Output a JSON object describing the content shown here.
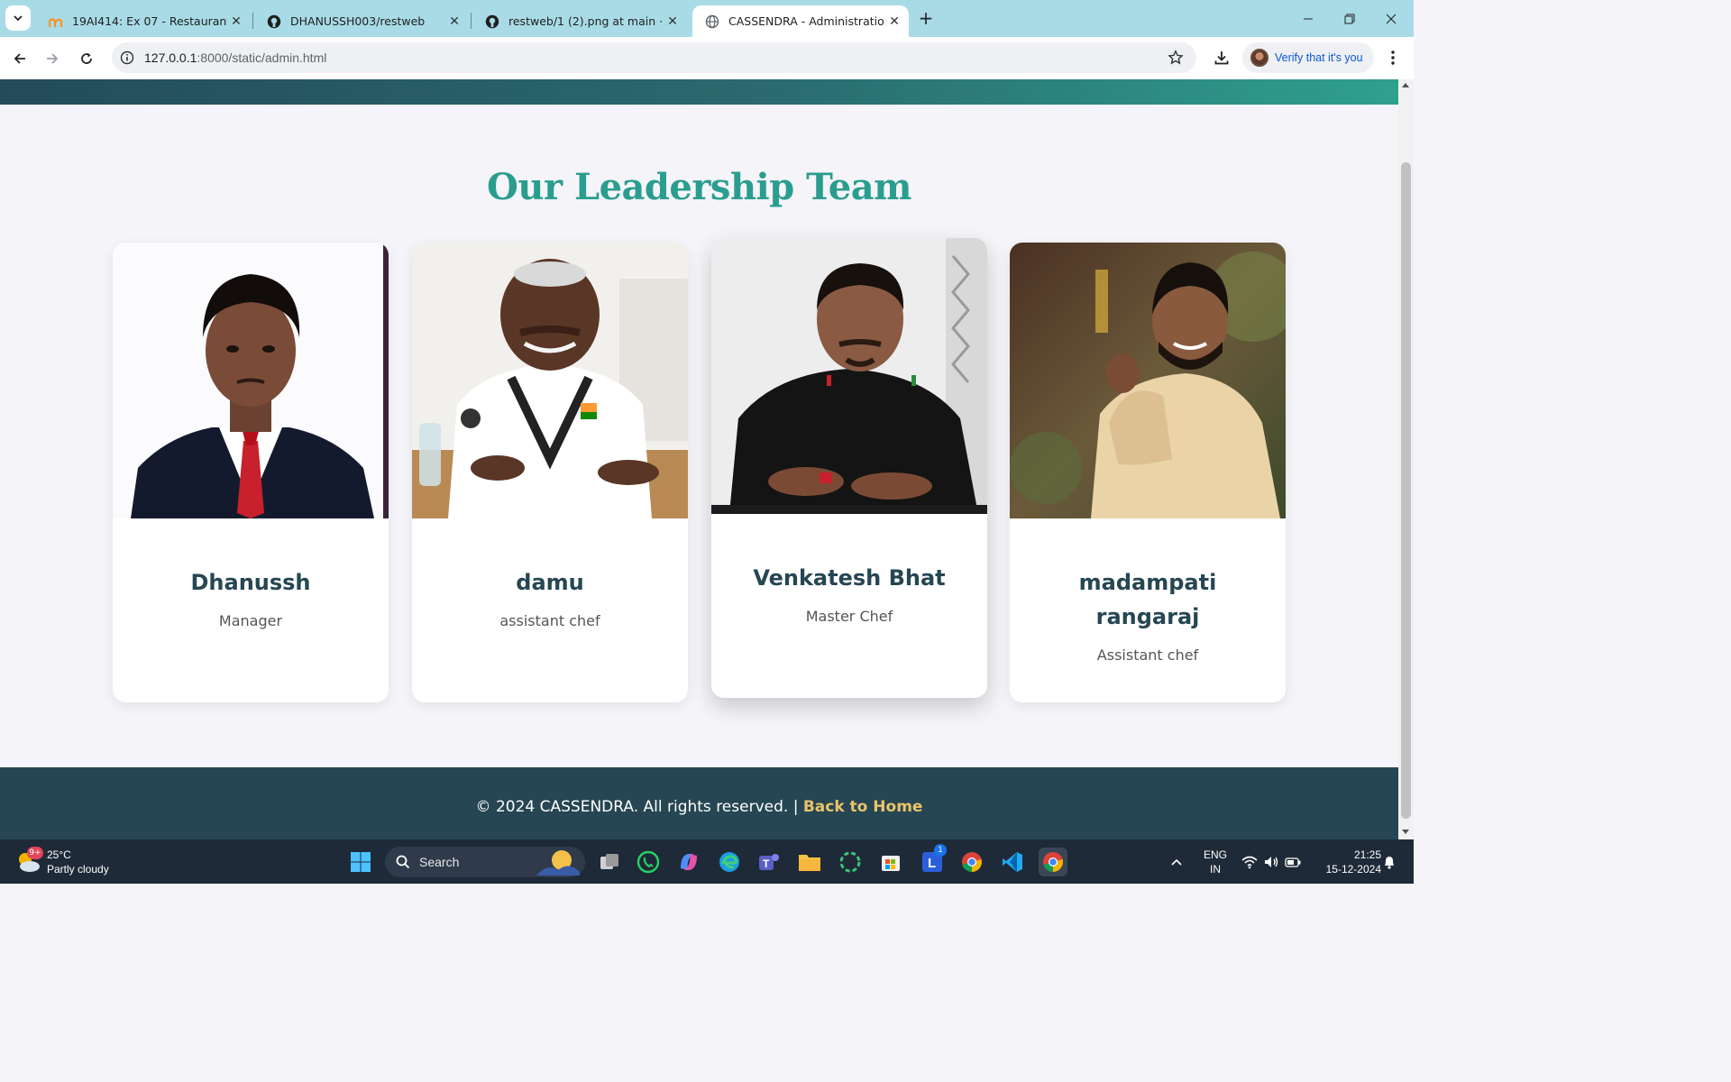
{
  "browser": {
    "tabs": [
      {
        "title": "19AI414: Ex 07 - Restaurant We",
        "favicon": "moodle-icon"
      },
      {
        "title": "DHANUSSH003/restweb",
        "favicon": "github-icon"
      },
      {
        "title": "restweb/1 (2).png at main · Dha",
        "favicon": "github-icon"
      },
      {
        "title": "CASSENDRA - Administration",
        "favicon": "globe-icon"
      }
    ],
    "address_host": "127.0.0.1",
    "address_path": ":8000/static/admin.html",
    "profile_button": "Verify that it's you"
  },
  "page": {
    "section_title": "Our Leadership Team",
    "team": [
      {
        "name": "Dhanussh",
        "role": "Manager"
      },
      {
        "name": "damu",
        "role": "assistant chef"
      },
      {
        "name": "Venkatesh Bhat",
        "role": "Master Chef"
      },
      {
        "name": "madampati rangaraj",
        "role": "Assistant chef"
      }
    ],
    "footer": {
      "copyright": "© 2024 CASSENDRA. All rights reserved. | ",
      "link": "Back to Home"
    }
  },
  "taskbar": {
    "weather_temp": "25°C",
    "weather_desc": "Partly cloudy",
    "weather_badge": "9+",
    "search_label": "Search",
    "lang_line1": "ENG",
    "lang_line2": "IN",
    "time": "21:25",
    "date": "15-12-2024",
    "app_badge": "1"
  },
  "colors": {
    "accent": "#2a9d8f",
    "footer_bg": "#264653",
    "link": "#e9c46a",
    "tab_strip": "#a8dbe6"
  }
}
